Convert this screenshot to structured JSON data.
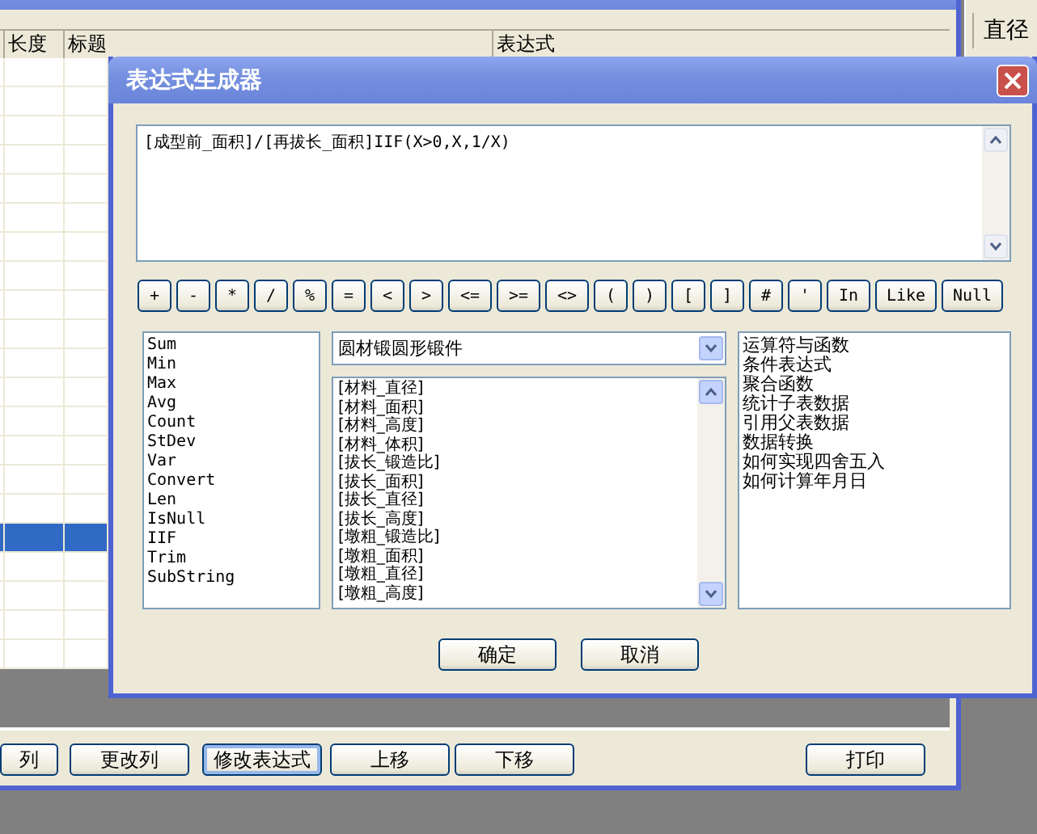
{
  "background_window": {
    "table": {
      "columns": [
        "长度",
        "标题",
        "表达式"
      ],
      "rows": [
        {
          "selected": false
        },
        {
          "selected": false
        },
        {
          "selected": false
        },
        {
          "selected": false
        },
        {
          "selected": false
        },
        {
          "selected": false
        },
        {
          "selected": false
        },
        {
          "selected": false
        },
        {
          "selected": false
        },
        {
          "selected": false
        },
        {
          "selected": false
        },
        {
          "selected": false
        },
        {
          "selected": false
        },
        {
          "selected": false
        },
        {
          "selected": false
        },
        {
          "selected": false
        },
        {
          "selected": true
        },
        {
          "selected": false
        },
        {
          "selected": false
        },
        {
          "selected": false
        },
        {
          "selected": false
        }
      ]
    },
    "buttons": [
      {
        "label": "列",
        "focused": false
      },
      {
        "label": "更改列",
        "focused": false
      },
      {
        "label": "修改表达式",
        "focused": true
      },
      {
        "label": "上移",
        "focused": false
      },
      {
        "label": "下移",
        "focused": false
      },
      {
        "label": "打印",
        "focused": false
      }
    ]
  },
  "side_window": {
    "header": "直径"
  },
  "dialog": {
    "title": "表达式生成器",
    "expression": "[成型前_面积]/[再拔长_面积]IIF(X>0,X,1/X)",
    "operators": [
      "+",
      "-",
      "*",
      "/",
      "%",
      "=",
      "<",
      ">",
      "<=",
      ">=",
      "<>",
      "(",
      ")",
      "[",
      "]",
      "#",
      "'",
      "In",
      "Like",
      "Null"
    ],
    "functions": [
      "Sum",
      "Min",
      "Max",
      "Avg",
      "Count",
      "StDev",
      "Var",
      "Convert",
      "Len",
      "IsNull",
      "IIF",
      "Trim",
      "SubString"
    ],
    "table_select": "圆材锻圆形锻件",
    "fields": [
      "[材料_直径]",
      "[材料_面积]",
      "[材料_高度]",
      "[材料_体积]",
      "[拔长_锻造比]",
      "[拔长_面积]",
      "[拔长_直径]",
      "[拔长_高度]",
      "[墩粗_锻造比]",
      "[墩粗_面积]",
      "[墩粗_直径]",
      "[墩粗_高度]"
    ],
    "help_topics": [
      "运算符与函数",
      "条件表达式",
      "聚合函数",
      "统计子表数据",
      "引用父表数据",
      "数据转换",
      "如何实现四舍五入",
      "如何计算年月日"
    ],
    "buttons": [
      "确定",
      "取消"
    ]
  }
}
